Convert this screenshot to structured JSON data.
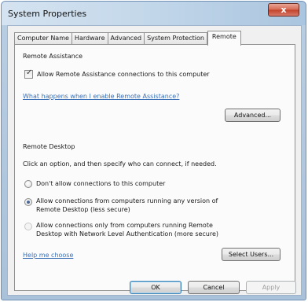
{
  "window": {
    "title": "System Properties",
    "close_label": "x"
  },
  "tabs": [
    {
      "label": "Computer Name"
    },
    {
      "label": "Hardware"
    },
    {
      "label": "Advanced"
    },
    {
      "label": "System Protection"
    },
    {
      "label": "Remote",
      "active": true
    }
  ],
  "remote_assistance": {
    "heading": "Remote Assistance",
    "allow_checkbox_label": "Allow Remote Assistance connections to this computer",
    "allow_checked": true,
    "help_link": "What happens when I enable Remote Assistance?",
    "advanced_button": "Advanced..."
  },
  "remote_desktop": {
    "heading": "Remote Desktop",
    "instruction": "Click an option, and then specify who can connect, if needed.",
    "options": [
      {
        "label_line1": "Don't allow connections to this computer",
        "label_line2": ""
      },
      {
        "label_line1": "Allow connections from computers running any version of",
        "label_line2": "Remote Desktop (less secure)",
        "selected": true
      },
      {
        "label_line1": "Allow connections only from computers running Remote",
        "label_line2": "Desktop with Network Level Authentication (more secure)",
        "disabled": true
      }
    ],
    "help_link": "Help me choose",
    "select_users_button": "Select Users..."
  },
  "footer": {
    "ok": "OK",
    "cancel": "Cancel",
    "apply": "Apply"
  }
}
